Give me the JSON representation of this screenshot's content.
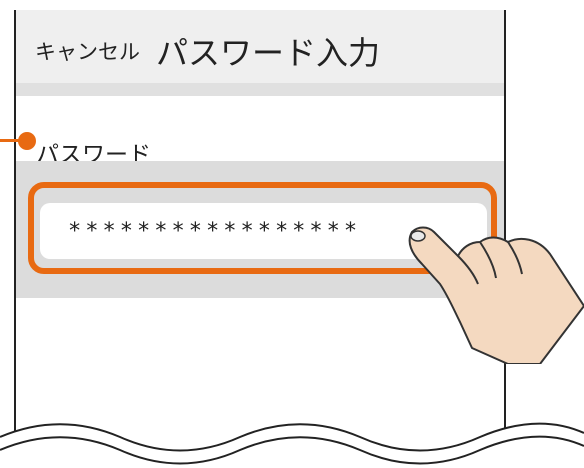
{
  "header": {
    "cancel_label": "キャンセル",
    "title": "パスワード入力"
  },
  "password_field": {
    "label": "パスワード",
    "value": "*****************"
  },
  "icons": {
    "pointer": "pointing-hand-icon",
    "callout": "callout-dot-icon"
  },
  "colors": {
    "accent": "#e86a12",
    "header_bg": "#efefef",
    "input_area_bg": "#dcdcdc"
  }
}
